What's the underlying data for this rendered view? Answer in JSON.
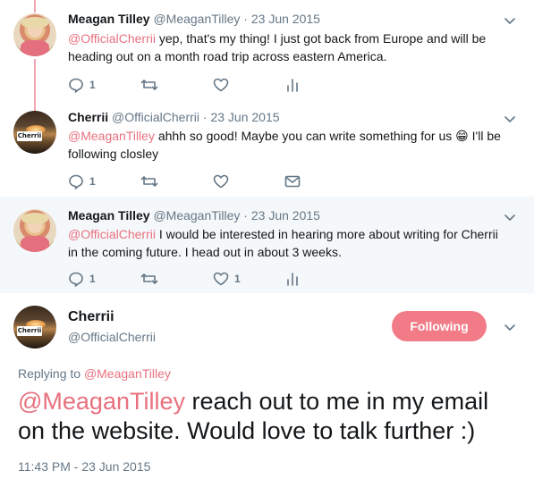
{
  "tweets": [
    {
      "name": "Meagan Tilley",
      "handle": "@MeaganTilley",
      "date": "23 Jun 2015",
      "mention": "@OfficialCherrii",
      "text": " yep, that's my thing! I just got back from Europe and will be heading out on a month road trip across eastern America.",
      "reply_count": "1",
      "like_count": ""
    },
    {
      "name": "Cherrii",
      "handle": "@OfficialCherrii",
      "date": "23 Jun 2015",
      "mention": "@MeaganTilley",
      "text_before_emoji": " ahhh so good! Maybe you can write something for us ",
      "emoji": "😁",
      "text_after_emoji": " I'll be following closley",
      "reply_count": "1"
    },
    {
      "name": "Meagan Tilley",
      "handle": "@MeaganTilley",
      "date": "23 Jun 2015",
      "mention": "@OfficialCherrii",
      "text": " I would be interested in hearing more about writing for Cherrii in the coming future. I head out in about 3 weeks.",
      "reply_count": "1",
      "like_count": "1"
    }
  ],
  "main_tweet": {
    "name": "Cherrii",
    "handle": "@OfficialCherrii",
    "follow_label": "Following",
    "replying_prefix": "Replying to ",
    "replying_to": "@MeaganTilley",
    "mention": "@MeaganTilley",
    "text": " reach out to me in my email on the website. Would love to talk further :)",
    "timestamp": "11:43 PM - 23 Jun 2015"
  },
  "avatar_logo_text": "Cherrii",
  "separator": " · ",
  "colors": {
    "accent_pink": "#e8717f",
    "follow_button": "#f17b86",
    "thread_line": "#f4a7b1",
    "muted": "#657786"
  }
}
